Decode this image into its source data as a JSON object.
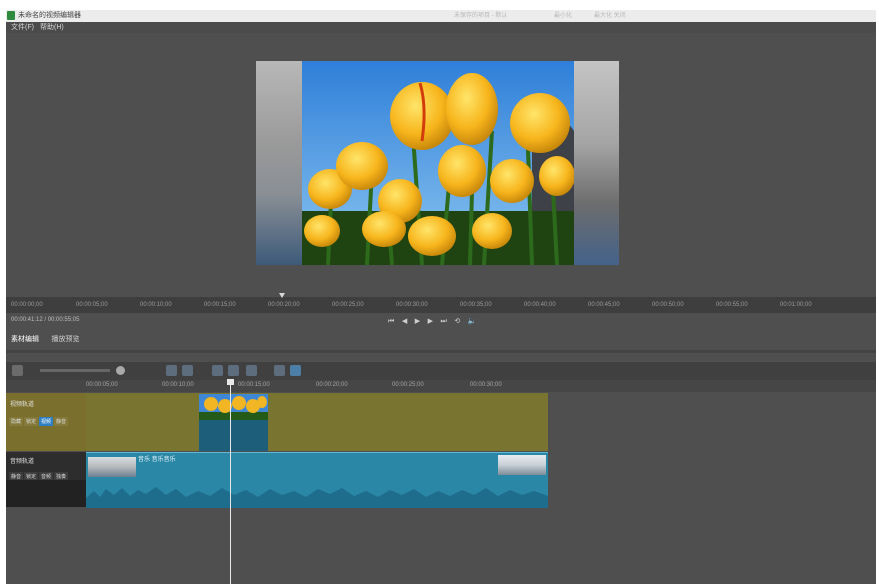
{
  "window": {
    "title": "未命名的视频编辑器",
    "right_items": [
      "未保存的项目 - 默认",
      "最小化",
      "最大化 关闭"
    ]
  },
  "menubar": {
    "items": [
      "文件(F)",
      "帮助(H)"
    ]
  },
  "preview": {
    "image": "yellow-tulips-photo"
  },
  "ruler": {
    "ticks": [
      "00:00:00;00",
      "00:00:05;00",
      "00:00:10;00",
      "00:00:15;00",
      "00:00:20;00",
      "00:00:25;00",
      "00:00:30;00",
      "00:00:35;00",
      "00:00:40;00",
      "00:00:45;00",
      "00:00:50;00",
      "00:00:55;00",
      "00:01:00;00"
    ]
  },
  "timecode": {
    "current": "00:00:41:12",
    "total": "00:00:55;05"
  },
  "transport": {
    "icons": [
      "go-start-icon",
      "prev-frame-icon",
      "play-icon",
      "next-frame-icon",
      "go-end-icon",
      "loop-icon",
      "volume-icon"
    ]
  },
  "tabs": [
    "素材编辑",
    "播放预览"
  ],
  "timeline_ruler": {
    "ticks": [
      "00:00:05;00",
      "00:00:10;00",
      "00:00:15;00",
      "00:00:20;00",
      "00:00:25;00",
      "00:00:30;00"
    ]
  },
  "tracks": {
    "video": {
      "label": "视频轨道",
      "buttons": [
        "隐藏",
        "锁定",
        "视频",
        "静音"
      ],
      "active": "视频"
    },
    "audio": {
      "label": "音频轨道",
      "buttons": [
        "静音",
        "锁定",
        "音频",
        "独奏"
      ],
      "clip_name": "音乐 音乐音乐"
    }
  }
}
